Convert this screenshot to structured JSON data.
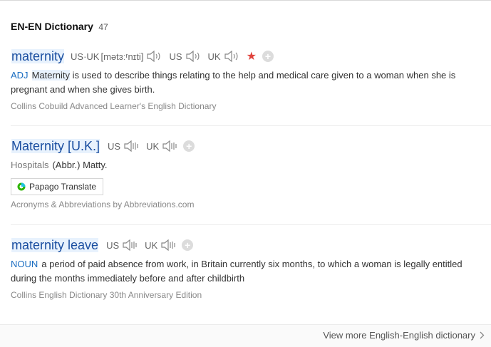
{
  "header": {
    "title": "EN-EN Dictionary",
    "count": "47"
  },
  "entries": [
    {
      "word": "maternity",
      "pron_label": "US·UK",
      "pron": "[mətɜːʳnɪti]",
      "us_label": "US",
      "uk_label": "UK",
      "pos": "ADJ",
      "keyword": "Maternity",
      "definition": " is used to describe things relating to the help and medical care given to a woman when she is pregnant and when she gives birth.",
      "source": "Collins Cobuild Advanced Learner's English Dictionary"
    },
    {
      "word": "Maternity [U.K.]",
      "us_label": "US",
      "uk_label": "UK",
      "category": "Hospitals",
      "definition": "(Abbr.) Matty.",
      "translate_label": "Papago Translate",
      "source": "Acronyms & Abbreviations by Abbreviations.com"
    },
    {
      "word": "maternity leave",
      "us_label": "US",
      "uk_label": "UK",
      "pos": "NOUN",
      "definition": "a period of paid absence from work, in Britain currently six months, to which a woman is legally entitled during the months immediately before and after childbirth",
      "source": "Collins English Dictionary 30th Anniversary Edition"
    }
  ],
  "footer": {
    "more_label": "View more English-English dictionary"
  },
  "colors": {
    "word": "#1a4ea0",
    "pos": "#1a6dc1",
    "star": "#e0433c",
    "highlight": "#e8f2fd"
  },
  "icons": [
    "speaker-icon",
    "star-icon",
    "plus-icon",
    "papago-icon",
    "chevron-right-icon"
  ]
}
